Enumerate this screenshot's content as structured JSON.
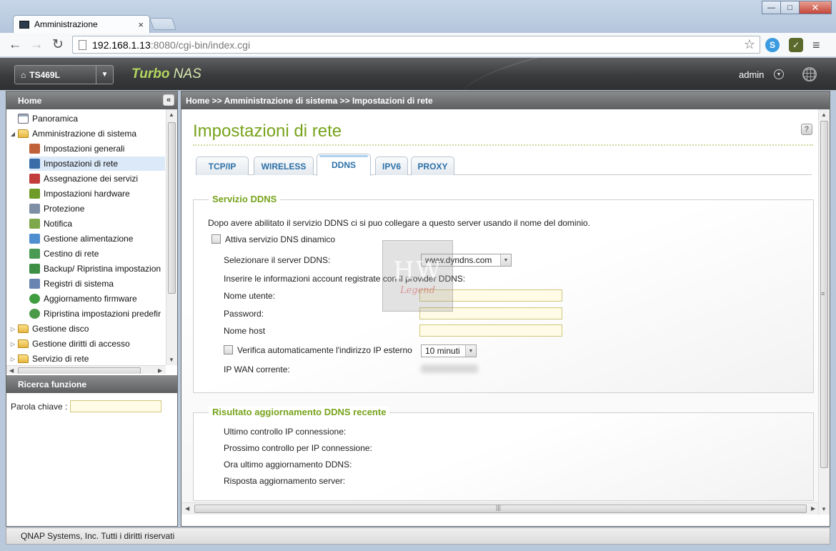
{
  "browser": {
    "tab_title": "Amministrazione",
    "tab_close": "×",
    "url_host": "192.168.1.13",
    "url_rest": ":8080/cgi-bin/index.cgi",
    "window": {
      "minimize": "—",
      "maximize": "□",
      "close": "✕"
    }
  },
  "header": {
    "device": "TS469L",
    "brand_bold": "Turbo",
    "brand_rest": " NAS",
    "user": "admin"
  },
  "sidebar": {
    "title": "Home",
    "collapse": "«",
    "items": [
      {
        "label": "Panoramica",
        "icon": "overview-icon",
        "color": "#5a7fa8"
      },
      {
        "label": "Amministrazione di sistema",
        "icon": "folder-open-icon",
        "color": "#e6b63e"
      },
      {
        "label": "Impostazioni generali",
        "icon": "general-settings-icon",
        "color": "#c0613a"
      },
      {
        "label": "Impostazioni di rete",
        "icon": "network-icon",
        "color": "#3a6da8"
      },
      {
        "label": "Assegnazione dei servizi",
        "icon": "services-icon",
        "color": "#c23c3c"
      },
      {
        "label": "Impostazioni hardware",
        "icon": "hardware-icon",
        "color": "#6e9b2a"
      },
      {
        "label": "Protezione",
        "icon": "lock-icon",
        "color": "#7e8fa5"
      },
      {
        "label": "Notifica",
        "icon": "notification-icon",
        "color": "#7ea84b"
      },
      {
        "label": "Gestione alimentazione",
        "icon": "power-icon",
        "color": "#4f8fcf"
      },
      {
        "label": "Cestino di rete",
        "icon": "recycle-bin-icon",
        "color": "#4a9a54"
      },
      {
        "label": "Backup/ Ripristina impostazion",
        "icon": "backup-icon",
        "color": "#3d8f45"
      },
      {
        "label": "Registri di sistema",
        "icon": "logs-icon",
        "color": "#6a84b2"
      },
      {
        "label": "Aggiornamento firmware",
        "icon": "firmware-icon",
        "color": "#3f9d3f"
      },
      {
        "label": "Ripristina impostazioni predefir",
        "icon": "restore-icon",
        "color": "#4a9a4a"
      },
      {
        "label": "Gestione disco",
        "icon": "folder-icon",
        "color": "#e6b63e"
      },
      {
        "label": "Gestione diritti di accesso",
        "icon": "folder-icon",
        "color": "#e6b63e"
      },
      {
        "label": "Servizio di rete",
        "icon": "folder-icon",
        "color": "#e6b63e"
      }
    ]
  },
  "search": {
    "title": "Ricerca funzione",
    "label": "Parola chiave :"
  },
  "main": {
    "breadcrumb": "Home >> Amministrazione di sistema >> Impostazioni di rete",
    "title": "Impostazioni di rete",
    "help": "?",
    "tabs": [
      {
        "label": "TCP/IP"
      },
      {
        "label": "WIRELESS"
      },
      {
        "label": "DDNS",
        "active": true
      },
      {
        "label": "IPV6"
      },
      {
        "label": "PROXY"
      }
    ]
  },
  "ddns": {
    "legend": "Servizio DDNS",
    "intro": "Dopo avere abilitato il servizio DDNS ci si puo collegare a questo server usando il nome del dominio.",
    "enable_label": "Attiva servizio DNS dinamico",
    "server_label": "Selezionare il server DDNS:",
    "server_value": "www.dyndns.com",
    "account_info": "Inserire le informazioni account registrate con il provider DDNS:",
    "username_label": "Nome utente:",
    "password_label": "Password:",
    "host_label": "Nome host",
    "autocheck_label": "Verifica automaticamente l'indirizzo IP esterno",
    "interval_value": "10 minuti",
    "wan_ip_label": "IP WAN corrente:"
  },
  "results": {
    "legend": "Risultato aggiornamento DDNS recente",
    "last_check": "Ultimo controllo IP connessione:",
    "next_check": "Prossimo controllo per IP connessione:",
    "last_update": "Ora ultimo aggiornamento DDNS:",
    "server_response": "Risposta aggiornamento server:"
  },
  "watermark": {
    "big": "HW",
    "small": "Legend"
  },
  "footer": {
    "text": "QNAP Systems, Inc. Tutti i diritti riservati"
  },
  "colors": {
    "accent_green": "#77a31b",
    "tab_blue": "#2c71a8",
    "header_dark": "#3a3b3d"
  }
}
